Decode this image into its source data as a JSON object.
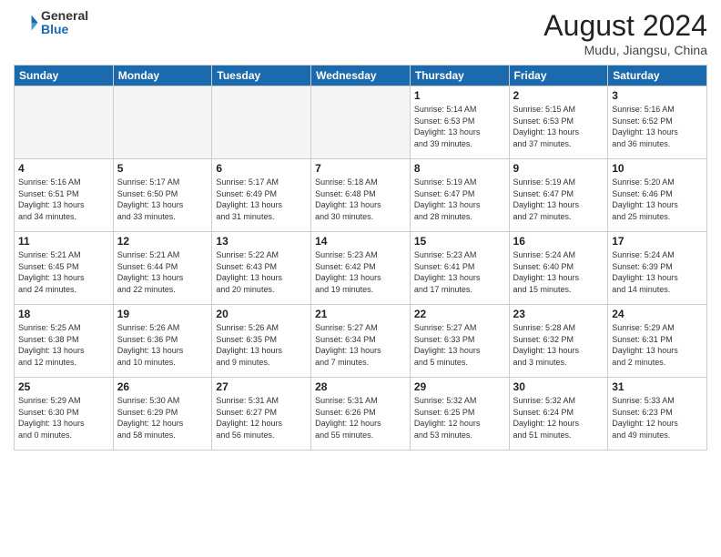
{
  "header": {
    "logo_general": "General",
    "logo_blue": "Blue",
    "month_title": "August 2024",
    "location": "Mudu, Jiangsu, China"
  },
  "days_of_week": [
    "Sunday",
    "Monday",
    "Tuesday",
    "Wednesday",
    "Thursday",
    "Friday",
    "Saturday"
  ],
  "weeks": [
    [
      {
        "day": "",
        "info": ""
      },
      {
        "day": "",
        "info": ""
      },
      {
        "day": "",
        "info": ""
      },
      {
        "day": "",
        "info": ""
      },
      {
        "day": "1",
        "info": "Sunrise: 5:14 AM\nSunset: 6:53 PM\nDaylight: 13 hours\nand 39 minutes."
      },
      {
        "day": "2",
        "info": "Sunrise: 5:15 AM\nSunset: 6:53 PM\nDaylight: 13 hours\nand 37 minutes."
      },
      {
        "day": "3",
        "info": "Sunrise: 5:16 AM\nSunset: 6:52 PM\nDaylight: 13 hours\nand 36 minutes."
      }
    ],
    [
      {
        "day": "4",
        "info": "Sunrise: 5:16 AM\nSunset: 6:51 PM\nDaylight: 13 hours\nand 34 minutes."
      },
      {
        "day": "5",
        "info": "Sunrise: 5:17 AM\nSunset: 6:50 PM\nDaylight: 13 hours\nand 33 minutes."
      },
      {
        "day": "6",
        "info": "Sunrise: 5:17 AM\nSunset: 6:49 PM\nDaylight: 13 hours\nand 31 minutes."
      },
      {
        "day": "7",
        "info": "Sunrise: 5:18 AM\nSunset: 6:48 PM\nDaylight: 13 hours\nand 30 minutes."
      },
      {
        "day": "8",
        "info": "Sunrise: 5:19 AM\nSunset: 6:47 PM\nDaylight: 13 hours\nand 28 minutes."
      },
      {
        "day": "9",
        "info": "Sunrise: 5:19 AM\nSunset: 6:47 PM\nDaylight: 13 hours\nand 27 minutes."
      },
      {
        "day": "10",
        "info": "Sunrise: 5:20 AM\nSunset: 6:46 PM\nDaylight: 13 hours\nand 25 minutes."
      }
    ],
    [
      {
        "day": "11",
        "info": "Sunrise: 5:21 AM\nSunset: 6:45 PM\nDaylight: 13 hours\nand 24 minutes."
      },
      {
        "day": "12",
        "info": "Sunrise: 5:21 AM\nSunset: 6:44 PM\nDaylight: 13 hours\nand 22 minutes."
      },
      {
        "day": "13",
        "info": "Sunrise: 5:22 AM\nSunset: 6:43 PM\nDaylight: 13 hours\nand 20 minutes."
      },
      {
        "day": "14",
        "info": "Sunrise: 5:23 AM\nSunset: 6:42 PM\nDaylight: 13 hours\nand 19 minutes."
      },
      {
        "day": "15",
        "info": "Sunrise: 5:23 AM\nSunset: 6:41 PM\nDaylight: 13 hours\nand 17 minutes."
      },
      {
        "day": "16",
        "info": "Sunrise: 5:24 AM\nSunset: 6:40 PM\nDaylight: 13 hours\nand 15 minutes."
      },
      {
        "day": "17",
        "info": "Sunrise: 5:24 AM\nSunset: 6:39 PM\nDaylight: 13 hours\nand 14 minutes."
      }
    ],
    [
      {
        "day": "18",
        "info": "Sunrise: 5:25 AM\nSunset: 6:38 PM\nDaylight: 13 hours\nand 12 minutes."
      },
      {
        "day": "19",
        "info": "Sunrise: 5:26 AM\nSunset: 6:36 PM\nDaylight: 13 hours\nand 10 minutes."
      },
      {
        "day": "20",
        "info": "Sunrise: 5:26 AM\nSunset: 6:35 PM\nDaylight: 13 hours\nand 9 minutes."
      },
      {
        "day": "21",
        "info": "Sunrise: 5:27 AM\nSunset: 6:34 PM\nDaylight: 13 hours\nand 7 minutes."
      },
      {
        "day": "22",
        "info": "Sunrise: 5:27 AM\nSunset: 6:33 PM\nDaylight: 13 hours\nand 5 minutes."
      },
      {
        "day": "23",
        "info": "Sunrise: 5:28 AM\nSunset: 6:32 PM\nDaylight: 13 hours\nand 3 minutes."
      },
      {
        "day": "24",
        "info": "Sunrise: 5:29 AM\nSunset: 6:31 PM\nDaylight: 13 hours\nand 2 minutes."
      }
    ],
    [
      {
        "day": "25",
        "info": "Sunrise: 5:29 AM\nSunset: 6:30 PM\nDaylight: 13 hours\nand 0 minutes."
      },
      {
        "day": "26",
        "info": "Sunrise: 5:30 AM\nSunset: 6:29 PM\nDaylight: 12 hours\nand 58 minutes."
      },
      {
        "day": "27",
        "info": "Sunrise: 5:31 AM\nSunset: 6:27 PM\nDaylight: 12 hours\nand 56 minutes."
      },
      {
        "day": "28",
        "info": "Sunrise: 5:31 AM\nSunset: 6:26 PM\nDaylight: 12 hours\nand 55 minutes."
      },
      {
        "day": "29",
        "info": "Sunrise: 5:32 AM\nSunset: 6:25 PM\nDaylight: 12 hours\nand 53 minutes."
      },
      {
        "day": "30",
        "info": "Sunrise: 5:32 AM\nSunset: 6:24 PM\nDaylight: 12 hours\nand 51 minutes."
      },
      {
        "day": "31",
        "info": "Sunrise: 5:33 AM\nSunset: 6:23 PM\nDaylight: 12 hours\nand 49 minutes."
      }
    ]
  ]
}
